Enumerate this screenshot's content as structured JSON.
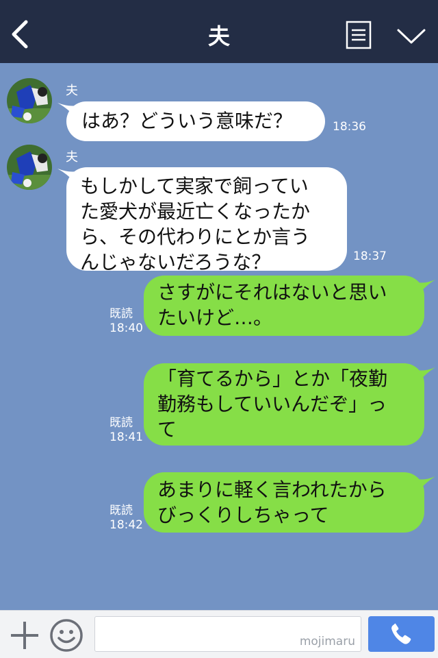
{
  "header": {
    "title": "夫",
    "back_icon": "chevron-left-icon",
    "note_icon": "notes-icon",
    "menu_icon": "chevron-down-icon",
    "background": "#232d45"
  },
  "chat": {
    "background": "#7393c4",
    "messages": [
      {
        "side": "in",
        "sender": "夫",
        "text": "はあ？どういう意味だ？",
        "time": "18:36"
      },
      {
        "side": "in",
        "sender": "夫",
        "text": "もしかして実家で飼ってい\nた愛犬が最近亡くなったか\nら、その代わりにとか言う\nんじゃないだろうな？",
        "time": "18:37"
      },
      {
        "side": "out",
        "read": "既読",
        "text": "さすがにそれはないと思い\nたいけど…。",
        "time": "18:40"
      },
      {
        "side": "out",
        "read": "既読",
        "text": "「育てるから」とか「夜勤\n勤務もしていいんだぞ」っ\nて",
        "time": "18:41"
      },
      {
        "side": "out",
        "read": "既読",
        "text": "あまりに軽く言われたから\nびっくりしちゃって",
        "time": "18:42"
      }
    ],
    "colors": {
      "incoming": "#ffffff",
      "outgoing": "#86de47"
    }
  },
  "footer": {
    "plus_icon": "plus-icon",
    "emoji_icon": "smiley-icon",
    "input_value": "",
    "watermark": "mojimaru",
    "call_icon": "phone-icon",
    "call_color": "#4f86e6"
  }
}
